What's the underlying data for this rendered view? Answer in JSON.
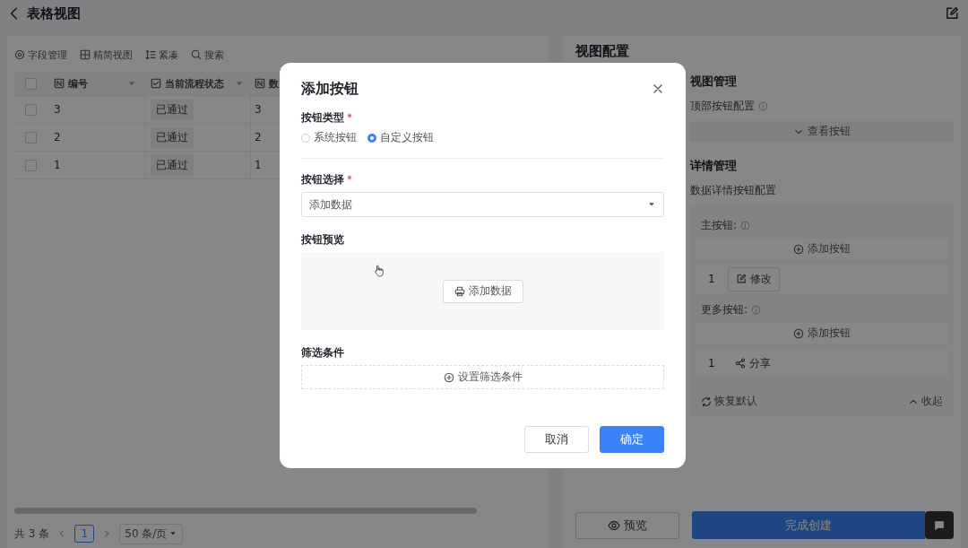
{
  "page": {
    "title": "表格视图"
  },
  "toolbar": [
    {
      "label": "字段管理",
      "kind": "gear"
    },
    {
      "label": "精简视图",
      "kind": "grid"
    },
    {
      "label": "紧凑",
      "kind": "rows"
    },
    {
      "label": "搜索",
      "kind": "search"
    }
  ],
  "table": {
    "select_all": {
      "checked": false
    },
    "columns": [
      {
        "label": "编号",
        "kind": "number",
        "sortable": true
      },
      {
        "label": "当前流程状态",
        "kind": "check",
        "sortable": true
      },
      {
        "label": "数",
        "kind": "number"
      }
    ],
    "rows": [
      {
        "checked": false,
        "cells": [
          "3",
          "已通过",
          "3"
        ]
      },
      {
        "checked": false,
        "cells": [
          "2",
          "已通过",
          "2"
        ]
      },
      {
        "checked": false,
        "cells": [
          "1",
          "已通过",
          "1"
        ]
      }
    ]
  },
  "pagination": {
    "total": "共 3 条",
    "pages": [
      {
        "label": "1",
        "selected": true
      }
    ],
    "page_size": "50 条/页"
  },
  "config": {
    "title": "视图配置",
    "view_management": {
      "title": "视图管理",
      "label": "顶部按钮配置",
      "toggle": "查看按钮",
      "expanded": false
    },
    "detail_management": {
      "title": "详情管理",
      "label": "数据详情按钮配置",
      "groups": [
        {
          "label": "主按钮:",
          "add": "添加按钮",
          "buttons": [
            {
              "index": "1",
              "label": "修改",
              "kind": "edit"
            }
          ]
        },
        {
          "label": "更多按钮:",
          "add": "添加按钮",
          "buttons": [
            {
              "index": "1",
              "label": "分享",
              "kind": "share"
            }
          ]
        }
      ],
      "reset": "恢复默认",
      "collapse": "收起"
    },
    "footer": {
      "preview": "预览",
      "complete": "完成创建"
    }
  },
  "dialog": {
    "title": "添加按钮",
    "type_field": {
      "label": "按钮类型",
      "required": true,
      "options": [
        {
          "label": "系统按钮",
          "selected": false
        },
        {
          "label": "自定义按钮",
          "selected": true
        }
      ]
    },
    "select_field": {
      "label": "按钮选择",
      "required": true,
      "value": "添加数据"
    },
    "preview": {
      "label": "按钮预览",
      "button": {
        "label": "添加数据",
        "kind": "printer"
      }
    },
    "filter": {
      "label": "筛选条件",
      "button": "设置筛选条件"
    },
    "buttons": [
      {
        "label": "取消",
        "kind": "default"
      },
      {
        "label": "确定",
        "kind": "primary"
      }
    ]
  }
}
